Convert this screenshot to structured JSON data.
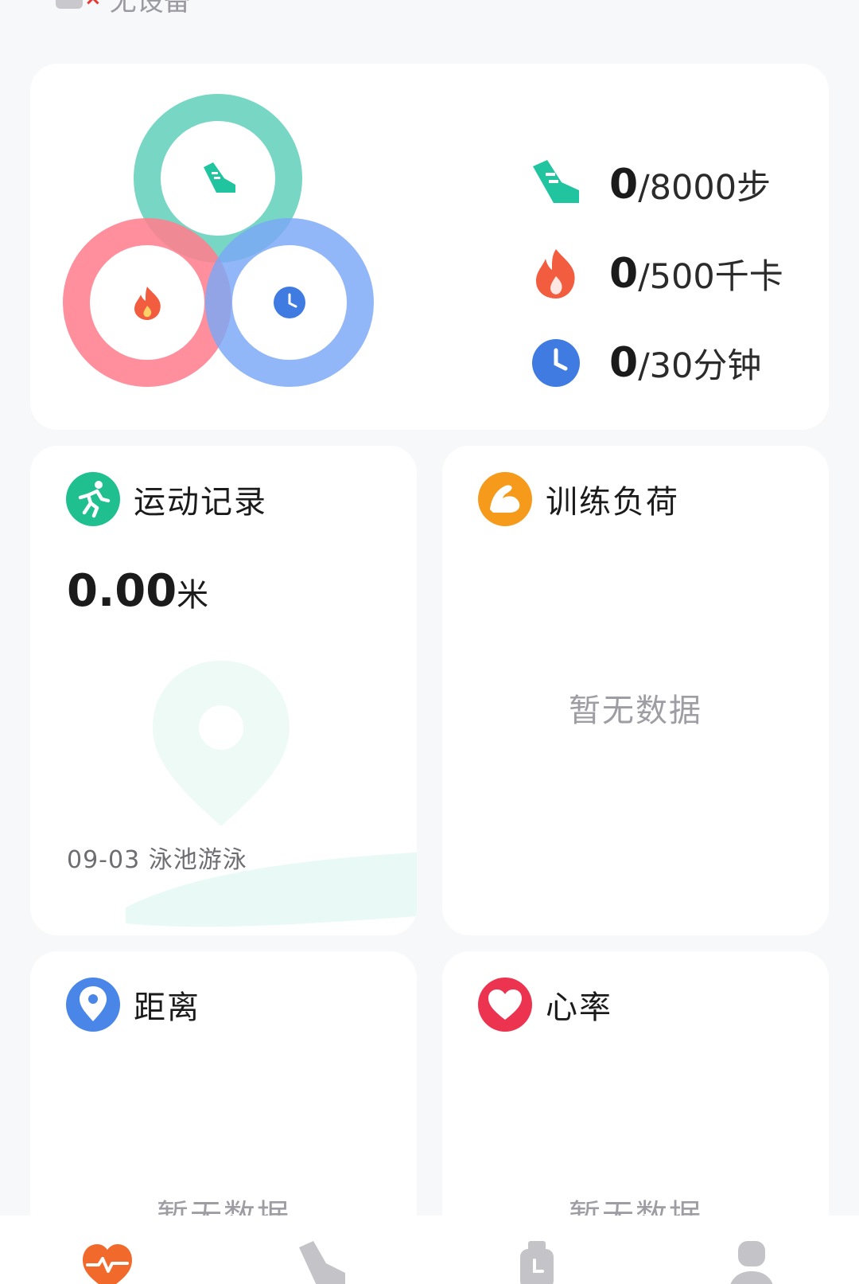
{
  "device": {
    "status_text": "无设备",
    "icon": "watch-disconnected-icon"
  },
  "goals": {
    "rings_icons": [
      "shoe-icon",
      "fire-icon",
      "clock-icon"
    ],
    "colors": {
      "steps": "#6dd3bf",
      "calories": "#ff7f8e",
      "minutes": "#7aa7f7"
    },
    "items": [
      {
        "icon": "shoe-icon",
        "value": "0",
        "target": "/8000步"
      },
      {
        "icon": "fire-icon",
        "value": "0",
        "target": "/500千卡"
      },
      {
        "icon": "clock-icon",
        "value": "0",
        "target": "/30分钟"
      }
    ]
  },
  "cards": {
    "exercise_record": {
      "icon": "running-person-icon",
      "title": "运动记录",
      "distance_value": "0.00",
      "distance_unit": "米",
      "last_activity": "09-03 泳池游泳"
    },
    "training_load": {
      "icon": "flexed-arm-icon",
      "title": "训练负荷",
      "empty": "暂无数据"
    },
    "distance": {
      "icon": "location-pin-icon",
      "title": "距离",
      "empty": "暂无数据"
    },
    "heart_rate": {
      "icon": "heart-icon",
      "title": "心率",
      "empty": "暂无数据"
    }
  },
  "bottom_nav": {
    "items": [
      {
        "name": "health",
        "icon": "heart-pulse-icon",
        "active": true,
        "color": "#f26a2b"
      },
      {
        "name": "sport",
        "icon": "shoe-icon",
        "active": false,
        "color": "#c4c4c8"
      },
      {
        "name": "device",
        "icon": "watch-icon",
        "active": false,
        "color": "#c4c4c8"
      },
      {
        "name": "profile",
        "icon": "person-icon",
        "active": false,
        "color": "#c4c4c8"
      }
    ]
  }
}
